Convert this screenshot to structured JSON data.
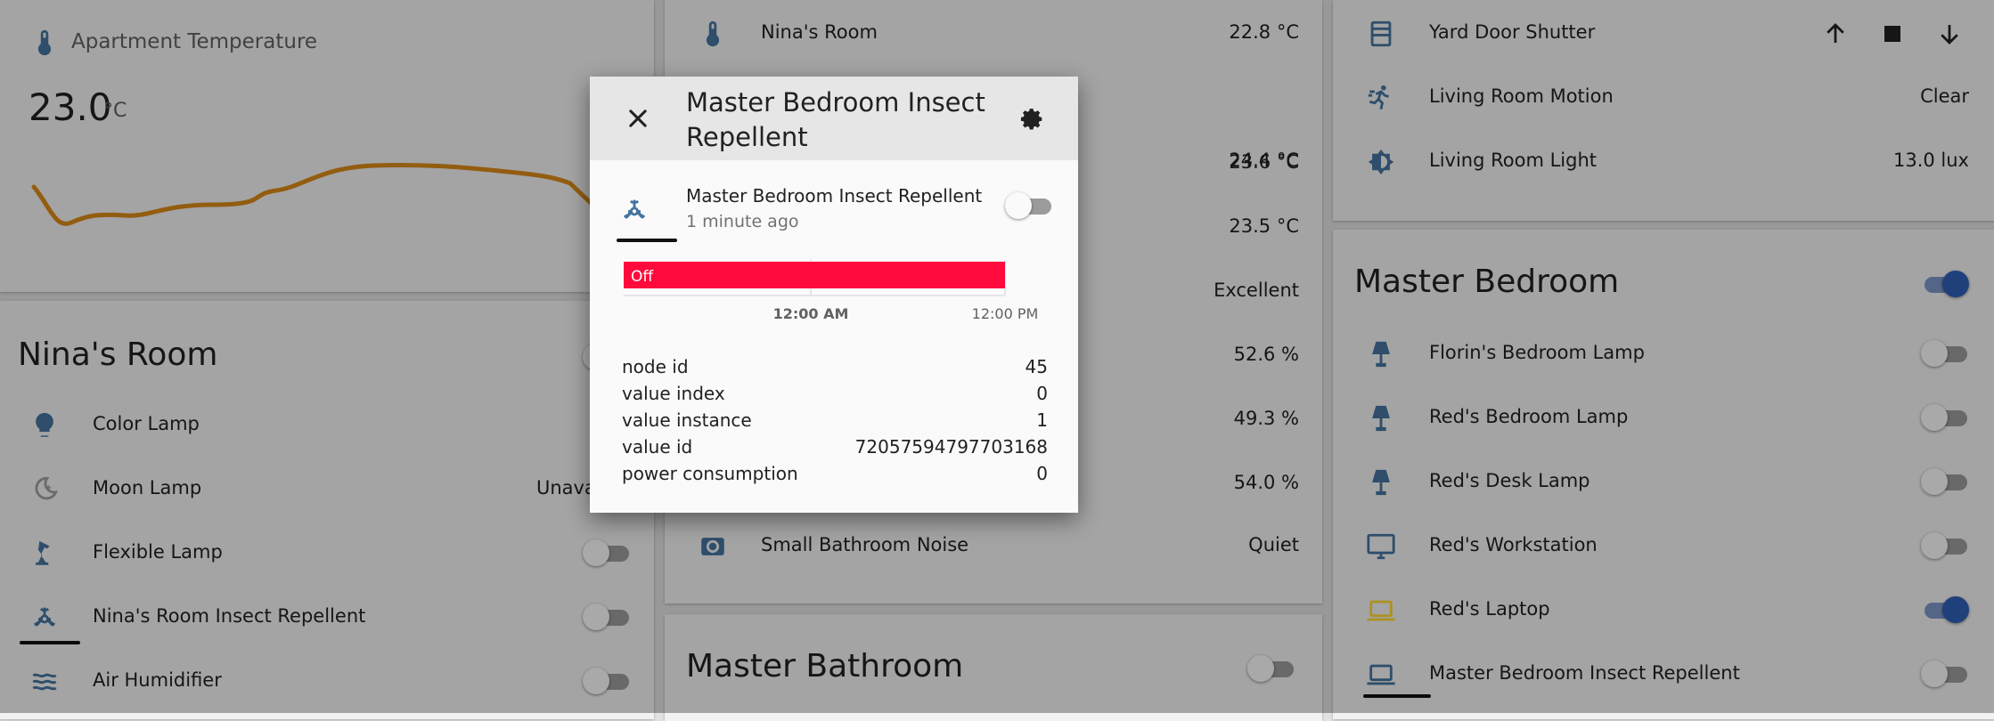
{
  "temp_card": {
    "title": "Apartment Temperature",
    "value": "23.0",
    "unit": "°C",
    "graph_color": "#d98a18"
  },
  "ninas_room": {
    "title": "Nina's Room",
    "items": [
      {
        "label": "Color Lamp",
        "icon": "lightbulb-icon"
      },
      {
        "label": "Moon Lamp",
        "icon": "moon-lamp-icon",
        "value": "Unava"
      },
      {
        "label": "Flexible Lamp",
        "icon": "desk-lamp-icon",
        "state": "off"
      },
      {
        "label": "Nina's Room Insect Repellent",
        "icon": "biohazard-icon",
        "state": "off"
      },
      {
        "label": "Air Humidifier",
        "icon": "waves-icon",
        "state": "off"
      }
    ]
  },
  "sensors": {
    "items": [
      {
        "label": "Nina's Room",
        "value": "22.8 °C",
        "icon": "thermometer-icon"
      },
      {
        "value": "24.4 °C"
      },
      {
        "value": "23.6 °C"
      },
      {
        "value": "23.5 °C"
      },
      {
        "value": "Excellent"
      },
      {
        "value": "52.6 %"
      },
      {
        "value": "49.3 %"
      },
      {
        "value": "54.0 %"
      },
      {
        "label": "Small Bathroom Noise",
        "value": "Quiet",
        "icon": "speaker-icon"
      }
    ]
  },
  "master_bathroom": {
    "title": "Master Bathroom"
  },
  "misc": {
    "items": [
      {
        "label": "Yard Door Shutter",
        "icon": "shutter-icon"
      },
      {
        "label": "Living Room Motion",
        "value": "Clear",
        "icon": "run-icon"
      },
      {
        "label": "Living Room Light",
        "value": "13.0 lux",
        "icon": "brightness-icon"
      }
    ]
  },
  "master_bedroom": {
    "title": "Master Bedroom",
    "items": [
      {
        "label": "Florin's Bedroom Lamp",
        "icon": "lamp-icon",
        "state": "off"
      },
      {
        "label": "Red's Bedroom Lamp",
        "icon": "lamp-icon",
        "state": "off"
      },
      {
        "label": "Red's Desk Lamp",
        "icon": "lamp-icon",
        "state": "off"
      },
      {
        "label": "Red's Workstation",
        "icon": "monitor-icon",
        "state": "off"
      },
      {
        "label": "Red's Laptop",
        "icon": "laptop-icon",
        "state": "on"
      },
      {
        "label": "Master Bedroom Insect Repellent",
        "icon": "laptop-icon",
        "state": "off"
      }
    ]
  },
  "dialog": {
    "title": "Master Bedroom Insect Repellent",
    "entity_name": "Master Bedroom Insect Repellent",
    "last_changed": "1 minute ago",
    "history": {
      "bar_label": "Off",
      "bar_color": "#ff0a3c",
      "tick_midnight": "12:00 AM",
      "tick_noon": "12:00 PM"
    },
    "attributes": [
      {
        "key": "node id",
        "value": "45"
      },
      {
        "key": "value index",
        "value": "0"
      },
      {
        "key": "value instance",
        "value": "1"
      },
      {
        "key": "value id",
        "value": "72057594797703168"
      },
      {
        "key": "power consumption",
        "value": "0"
      }
    ]
  },
  "colors": {
    "icon_blue": "#44739e",
    "icon_yellow": "#fdd835",
    "toggle_on": "#2f5fb6"
  }
}
